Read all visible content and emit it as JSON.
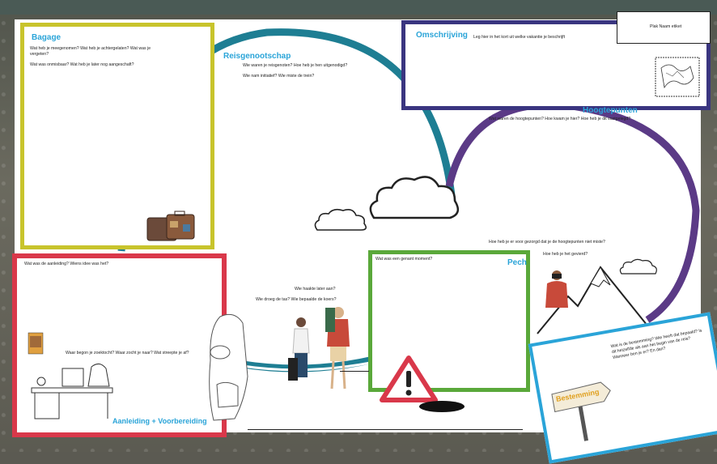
{
  "bagage": {
    "title": "Bagage",
    "q1": "Wat heb je meegenomen? Wat heb je achtergelaten? Wat was je vergeten?",
    "q2": "Wat was onmisbaar? Wat heb je later nog aangeschaft?"
  },
  "reisgenootschap": {
    "title": "Reisgenootschap",
    "q1": "Wie waren je reisgenoten? Hoe heb je hen uitgenodigd?",
    "q2": "Wie nam initiatief? Wie miste de trein?"
  },
  "omschrijving": {
    "title": "Omschrijving",
    "text": "Leg hier in het kort uit welke vakantie je beschrijft"
  },
  "naam_etiket": "Plak Naam etiket",
  "hoogtepunten": {
    "title": "Hoogtepunten",
    "q1": "Wat waren de hoogtepunten? Hoe kwam je hier? Hoe heb je dit vastgelegd?",
    "q2": "Hoe heb je er voor gezorgd dat je de hoogtepunten niet miste?",
    "q3": "Hoe heb je het gevierd?"
  },
  "aanleiding": {
    "title": "Aanleiding + Voorbereiding",
    "q1": "Wat was de aanleiding? Wiens idee was het?",
    "q2": "Waar begon je zoektocht? Waar zocht je naar? Wat streepte je af?"
  },
  "middle": {
    "q1": "Wie haakte later aan?",
    "q2": "Wie droeg de tas? Wie bepaalde de koers?"
  },
  "pech": {
    "title": "Pech",
    "q1": "Wat was een genant moment?"
  },
  "bestemming": {
    "q1": "Wat is de bestemming? Wie heeft dat bepaald? Is dit hetzelfde als aan het begin van de reis? Wanneer ben je er? En dan?",
    "sign": "Bestemming"
  },
  "colors": {
    "bagage": "#c8c42c",
    "aanleiding": "#d9384a",
    "pech": "#5aa83a",
    "omschrijving": "#3a3580",
    "hoogtepunten": "#5b3a86",
    "teal": "#1e7e93",
    "title_blue": "#2aa4d8"
  }
}
